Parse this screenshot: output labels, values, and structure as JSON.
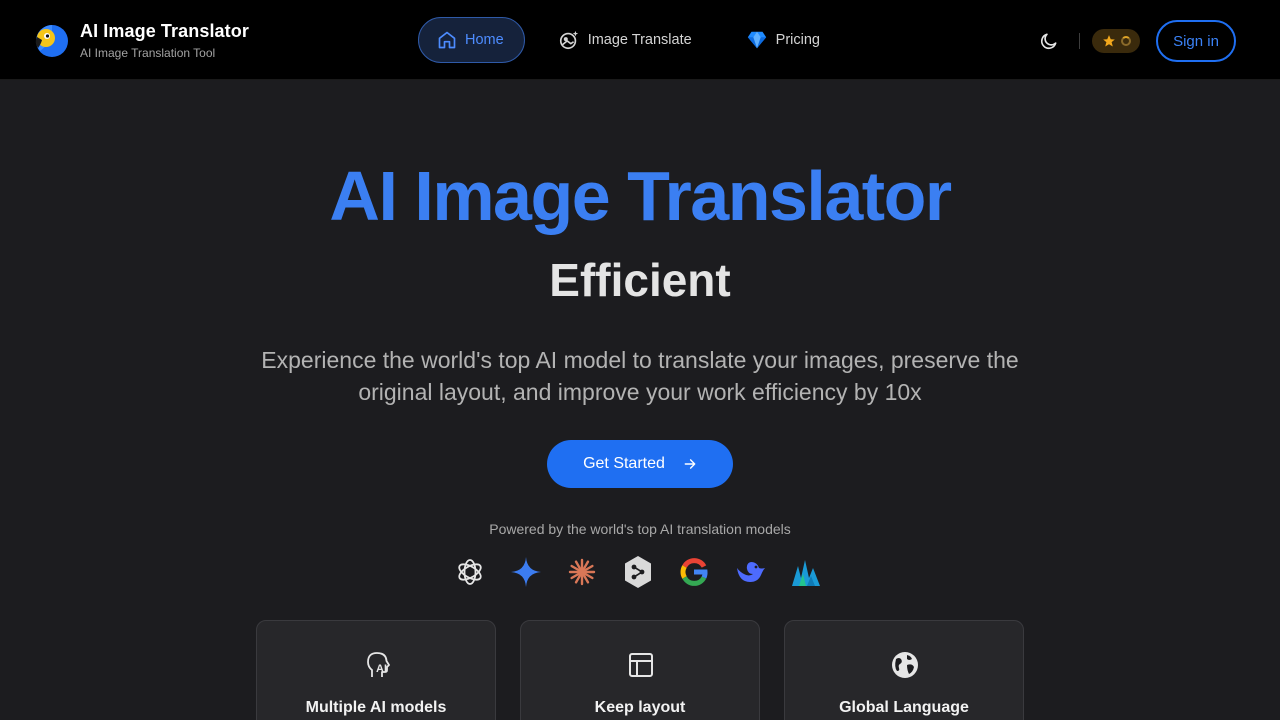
{
  "brand": {
    "title": "AI Image Translator",
    "subtitle": "AI Image Translation Tool",
    "logo_icon": "parrot-logo"
  },
  "nav": [
    {
      "label": "Home",
      "icon": "home-icon",
      "active": true
    },
    {
      "label": "Image Translate",
      "icon": "magic-image-icon",
      "active": false
    },
    {
      "label": "Pricing",
      "icon": "diamond-icon",
      "active": false
    }
  ],
  "header": {
    "theme_icon": "moon-icon",
    "credits_icon": "star-icon",
    "signin_label": "Sign in"
  },
  "hero": {
    "title": "AI Image Translator",
    "word": "Efficient",
    "description": "Experience the world's top AI model to translate your images, preserve the original layout, and improve your work efficiency by 10x",
    "cta_label": "Get Started"
  },
  "powered_by": {
    "text": "Powered by the world's top AI translation models",
    "models": [
      "openai-icon",
      "gemini-icon",
      "claude-icon",
      "deepl-icon",
      "google-icon",
      "deepseek-icon",
      "mistral-icon"
    ]
  },
  "features": [
    {
      "title": "Multiple AI models",
      "icon": "ai-head-icon"
    },
    {
      "title": "Keep layout",
      "icon": "layout-icon"
    },
    {
      "title": "Global Language",
      "icon": "globe-icon"
    }
  ],
  "colors": {
    "accent": "#1f6ff2",
    "title_blue": "#3b7ff2",
    "background": "#1c1c1f",
    "header_bg": "#000000"
  }
}
